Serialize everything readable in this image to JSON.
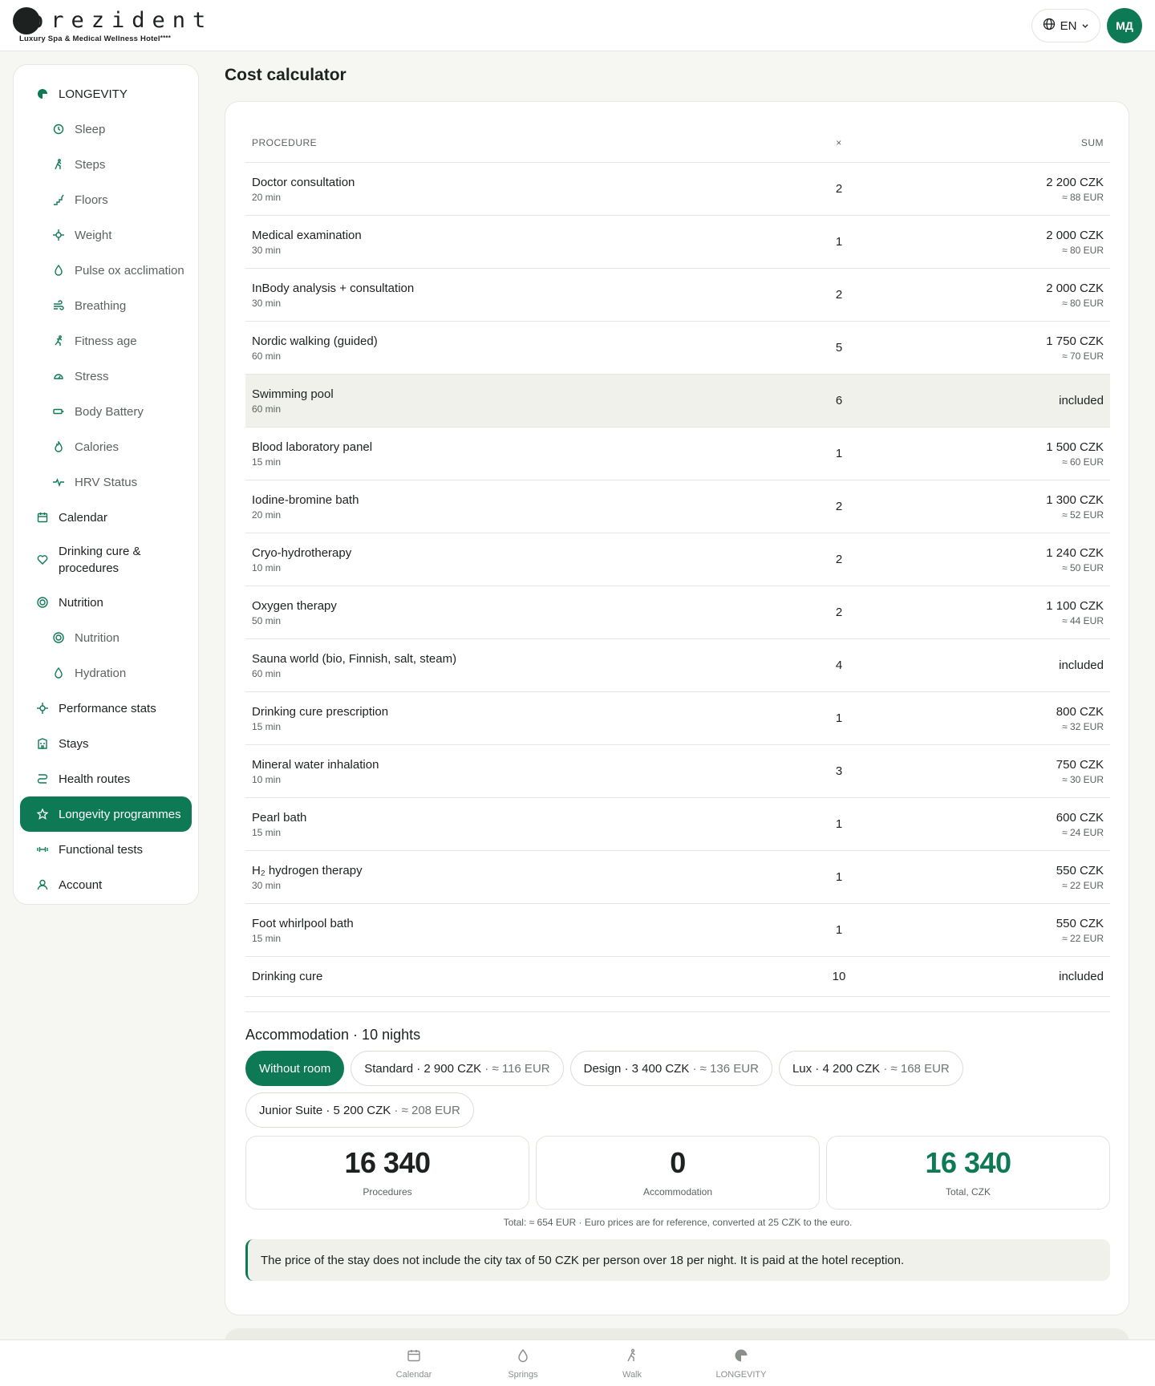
{
  "header": {
    "brand": "prezident",
    "brand_sub": "Luxury Spa & Medical Wellness Hotel",
    "brand_stars": "****",
    "language": "EN",
    "avatar_initials": "МД"
  },
  "sidebar": {
    "items": [
      {
        "label": "LONGEVITY",
        "icon": "longevity-icon"
      },
      {
        "label": "Sleep",
        "icon": "clock-icon"
      },
      {
        "label": "Steps",
        "icon": "walker-icon"
      },
      {
        "label": "Floors",
        "icon": "stairs-icon"
      },
      {
        "label": "Weight",
        "icon": "crosshair-icon"
      },
      {
        "label": "Pulse ox acclimation",
        "icon": "drop-icon"
      },
      {
        "label": "Breathing",
        "icon": "wind-icon"
      },
      {
        "label": "Fitness age",
        "icon": "runner-icon"
      },
      {
        "label": "Stress",
        "icon": "gauge-icon"
      },
      {
        "label": "Body Battery",
        "icon": "battery-icon"
      },
      {
        "label": "Calories",
        "icon": "flame-icon"
      },
      {
        "label": "HRV Status",
        "icon": "pulse-icon"
      },
      {
        "label": "Calendar",
        "icon": "calendar-icon"
      },
      {
        "label": "Drinking cure & procedures",
        "icon": "heart-icon"
      },
      {
        "label": "Nutrition",
        "icon": "target-icon"
      },
      {
        "label": "Nutrition",
        "icon": "target-icon"
      },
      {
        "label": "Hydration",
        "icon": "drop-icon"
      },
      {
        "label": "Performance stats",
        "icon": "crosshair-icon"
      },
      {
        "label": "Stays",
        "icon": "building-icon"
      },
      {
        "label": "Health routes",
        "icon": "route-icon"
      },
      {
        "label": "Longevity programmes",
        "icon": "star-icon"
      },
      {
        "label": "Functional tests",
        "icon": "dumbbell-icon"
      },
      {
        "label": "Account",
        "icon": "user-icon"
      }
    ]
  },
  "page": {
    "title": "Cost calculator"
  },
  "table": {
    "headers": {
      "procedure": "PROCEDURE",
      "times": "×",
      "sum": "SUM"
    },
    "rows": [
      {
        "name": "Doctor consultation",
        "duration": "20 min",
        "qty": "2",
        "czk": "2 200 CZK",
        "eur": "≈ 88 EUR"
      },
      {
        "name": "Medical examination",
        "duration": "30 min",
        "qty": "1",
        "czk": "2 000 CZK",
        "eur": "≈ 80 EUR"
      },
      {
        "name": "InBody analysis + consultation",
        "duration": "30 min",
        "qty": "2",
        "czk": "2 000 CZK",
        "eur": "≈ 80 EUR"
      },
      {
        "name": "Nordic walking (guided)",
        "duration": "60 min",
        "qty": "5",
        "czk": "1 750 CZK",
        "eur": "≈ 70 EUR"
      },
      {
        "name": "Swimming pool",
        "duration": "60 min",
        "qty": "6",
        "included": "included"
      },
      {
        "name": "Blood laboratory panel",
        "duration": "15 min",
        "qty": "1",
        "czk": "1 500 CZK",
        "eur": "≈ 60 EUR"
      },
      {
        "name": "Iodine-bromine bath",
        "duration": "20 min",
        "qty": "2",
        "czk": "1 300 CZK",
        "eur": "≈ 52 EUR"
      },
      {
        "name": "Cryo-hydrotherapy",
        "duration": "10 min",
        "qty": "2",
        "czk": "1 240 CZK",
        "eur": "≈ 50 EUR"
      },
      {
        "name": "Oxygen therapy",
        "duration": "50 min",
        "qty": "2",
        "czk": "1 100 CZK",
        "eur": "≈ 44 EUR"
      },
      {
        "name": "Sauna world (bio, Finnish, salt, steam)",
        "duration": "60 min",
        "qty": "4",
        "included": "included"
      },
      {
        "name": "Drinking cure prescription",
        "duration": "15 min",
        "qty": "1",
        "czk": "800 CZK",
        "eur": "≈ 32 EUR"
      },
      {
        "name": "Mineral water inhalation",
        "duration": "10 min",
        "qty": "3",
        "czk": "750 CZK",
        "eur": "≈ 30 EUR"
      },
      {
        "name": "Pearl bath",
        "duration": "15 min",
        "qty": "1",
        "czk": "600 CZK",
        "eur": "≈ 24 EUR"
      },
      {
        "name": "H₂ hydrogen therapy",
        "duration": "30 min",
        "qty": "1",
        "czk": "550 CZK",
        "eur": "≈ 22 EUR"
      },
      {
        "name": "Foot whirlpool bath",
        "duration": "15 min",
        "qty": "1",
        "czk": "550 CZK",
        "eur": "≈ 22 EUR"
      },
      {
        "name": "Drinking cure",
        "duration": "",
        "qty": "10",
        "included": "included"
      }
    ]
  },
  "accommodation": {
    "title": "Accommodation · 10 nights",
    "options": [
      {
        "label": "Without room",
        "eur": ""
      },
      {
        "label": "Standard · 2 900 CZK",
        "eur": " · ≈ 116 EUR"
      },
      {
        "label": "Design · 3 400 CZK",
        "eur": " · ≈ 136 EUR"
      },
      {
        "label": "Lux · 4 200 CZK",
        "eur": " · ≈ 168 EUR"
      },
      {
        "label": "Junior Suite · 5 200 CZK",
        "eur": " · ≈ 208 EUR"
      }
    ],
    "selected": "Without room"
  },
  "totals": {
    "procedures_value": "16 340",
    "procedures_label": "Procedures",
    "accommodation_value": "0",
    "accommodation_label": "Accommodation",
    "total_value": "16 340",
    "total_label": "Total, CZK",
    "note": "Total: ≈ 654 EUR · Euro prices are for reference, converted at 25 CZK to the euro."
  },
  "notice": "The price of the stay does not include the city tax of 50 CZK per person over 18 per night. It is paid at the hotel reception.",
  "bottom_nav": [
    {
      "label": "Calendar",
      "icon": "calendar-icon"
    },
    {
      "label": "Springs",
      "icon": "drop-icon"
    },
    {
      "label": "Walk",
      "icon": "walker-icon"
    },
    {
      "label": "LONGEVITY",
      "icon": "longevity-icon"
    }
  ],
  "colors": {
    "accent": "#0e7a55",
    "background": "#f6f6f2",
    "highlight_row": "#f1f1ec"
  }
}
